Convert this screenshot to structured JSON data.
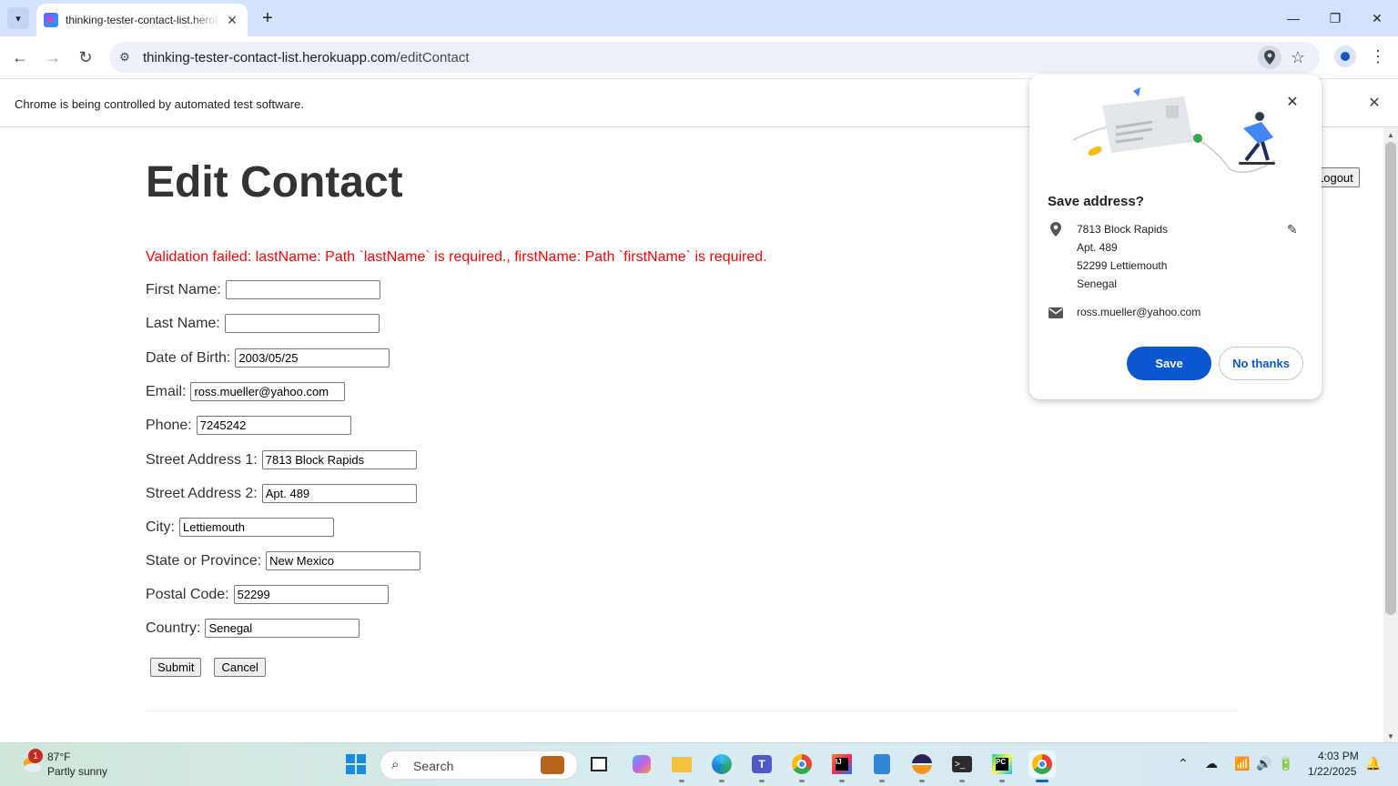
{
  "browser": {
    "tab_title": "thinking-tester-contact-list.herokuapp.com",
    "url_host": "thinking-tester-contact-list.herokuapp.com",
    "url_path": "/editContact",
    "infobar_text": "Chrome is being controlled by automated test software."
  },
  "page": {
    "title": "Edit Contact",
    "logout_label": "Logout",
    "error": "Validation failed: lastName: Path `lastName` is required., firstName: Path `firstName` is required.",
    "fields": [
      {
        "label": "First Name:",
        "value": ""
      },
      {
        "label": "Last Name:",
        "value": ""
      },
      {
        "label": "Date of Birth:",
        "value": "2003/05/25"
      },
      {
        "label": "Email:",
        "value": "ross.mueller@yahoo.com"
      },
      {
        "label": "Phone:",
        "value": "7245242"
      },
      {
        "label": "Street Address 1:",
        "value": "7813 Block Rapids"
      },
      {
        "label": "Street Address 2:",
        "value": "Apt. 489"
      },
      {
        "label": "City:",
        "value": "Lettiemouth"
      },
      {
        "label": "State or Province:",
        "value": "New Mexico"
      },
      {
        "label": "Postal Code:",
        "value": "52299"
      },
      {
        "label": "Country:",
        "value": "Senegal"
      }
    ],
    "submit_label": "Submit",
    "cancel_label": "Cancel"
  },
  "popup": {
    "title": "Save address?",
    "address_lines": [
      "7813 Block Rapids",
      "Apt. 489",
      "52299 Lettiemouth",
      "Senegal"
    ],
    "email": "ross.mueller@yahoo.com",
    "save_label": "Save",
    "no_thanks_label": "No thanks"
  },
  "taskbar": {
    "weather_badge": "1",
    "temperature": "87°F",
    "weather_desc": "Partly sunny",
    "search_placeholder": "Search",
    "time": "4:03 PM",
    "date": "1/22/2025"
  },
  "colors": {
    "accent": "#0b57d0",
    "error": "#ff0000",
    "titlebar": "#d3e3fd"
  }
}
